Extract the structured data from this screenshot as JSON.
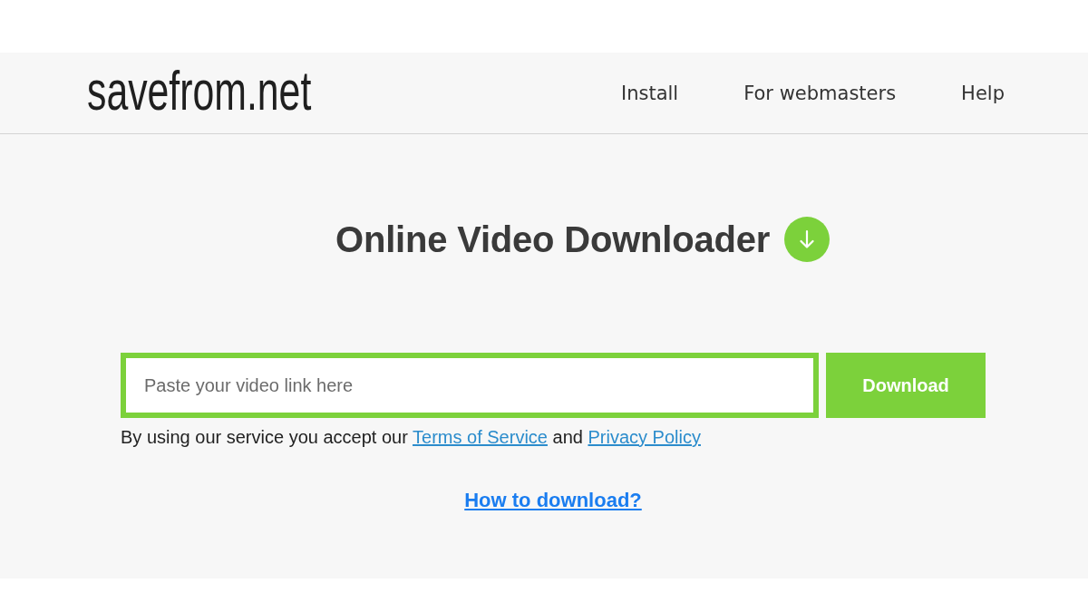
{
  "header": {
    "logo": "savefrom.net",
    "nav": [
      "Install",
      "For webmasters",
      "Help"
    ]
  },
  "hero": {
    "title": "Online Video Downloader"
  },
  "search": {
    "placeholder": "Paste your video link here",
    "button": "Download"
  },
  "consent": {
    "parts": [
      {
        "kind": "text",
        "text": "By using our service you accept our"
      },
      {
        "kind": "link",
        "text": "Terms of Service"
      },
      {
        "kind": "text",
        "text": "and"
      },
      {
        "kind": "link",
        "text": "Privacy Policy"
      }
    ]
  },
  "help_link": "How to download?"
}
